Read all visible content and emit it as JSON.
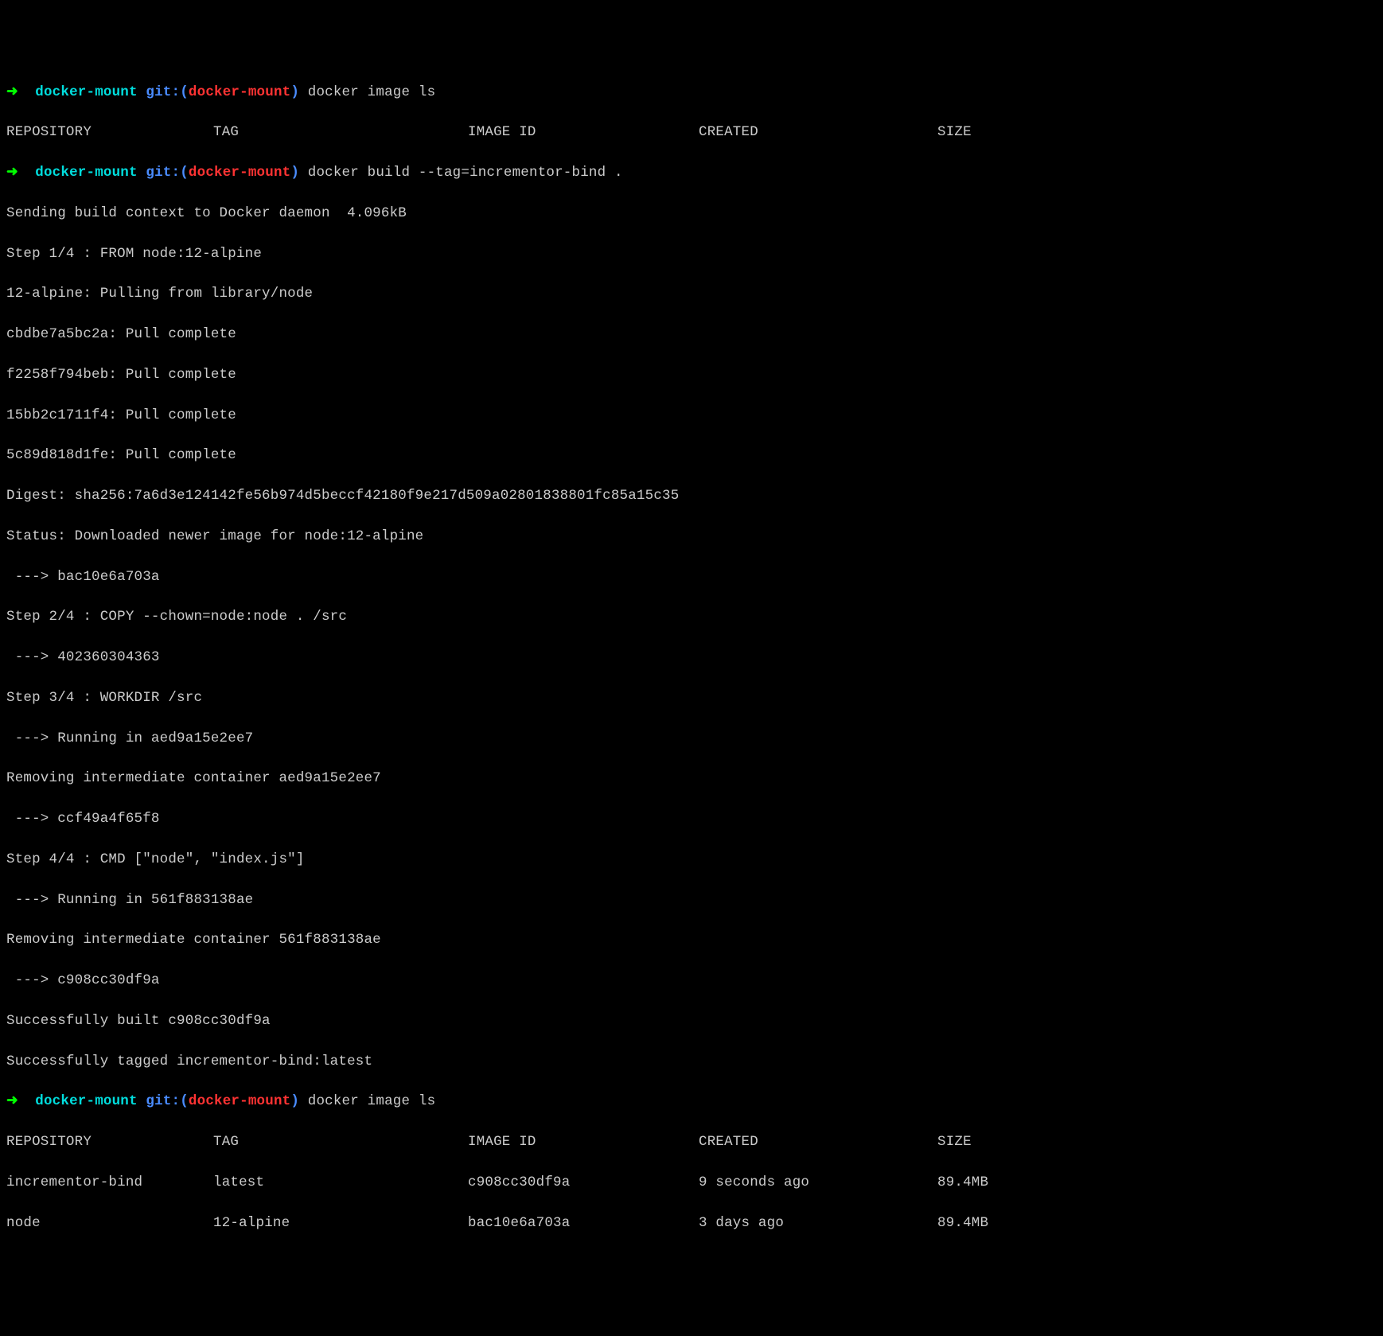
{
  "prompt": {
    "arrow": "➜",
    "dir": "docker-mount",
    "git_label": "git:(",
    "branch": "docker-mount",
    "git_close": ")"
  },
  "cmd1": "docker image ls",
  "table1": {
    "headers": {
      "repo": "REPOSITORY",
      "tag": "TAG",
      "id": "IMAGE ID",
      "created": "CREATED",
      "size": "SIZE"
    }
  },
  "cmd2": "docker build --tag=incrementor-bind .",
  "build_output": {
    "l0": "Sending build context to Docker daemon  4.096kB",
    "l1": "Step 1/4 : FROM node:12-alpine",
    "l2": "12-alpine: Pulling from library/node",
    "l3": "cbdbe7a5bc2a: Pull complete",
    "l4": "f2258f794beb: Pull complete",
    "l5": "15bb2c1711f4: Pull complete",
    "l6": "5c89d818d1fe: Pull complete",
    "l7": "Digest: sha256:7a6d3e124142fe56b974d5beccf42180f9e217d509a02801838801fc85a15c35",
    "l8": "Status: Downloaded newer image for node:12-alpine",
    "l9": " ---> bac10e6a703a",
    "l10": "Step 2/4 : COPY --chown=node:node . /src",
    "l11": " ---> 402360304363",
    "l12": "Step 3/4 : WORKDIR /src",
    "l13": " ---> Running in aed9a15e2ee7",
    "l14": "Removing intermediate container aed9a15e2ee7",
    "l15": " ---> ccf49a4f65f8",
    "l16": "Step 4/4 : CMD [\"node\", \"index.js\"]",
    "l17": " ---> Running in 561f883138ae",
    "l18": "Removing intermediate container 561f883138ae",
    "l19": " ---> c908cc30df9a",
    "l20": "Successfully built c908cc30df9a",
    "l21": "Successfully tagged incrementor-bind:latest"
  },
  "cmd3": "docker image ls",
  "table2": {
    "headers": {
      "repo": "REPOSITORY",
      "tag": "TAG",
      "id": "IMAGE ID",
      "created": "CREATED",
      "size": "SIZE"
    },
    "rows": [
      {
        "repo": "incrementor-bind",
        "tag": "latest",
        "id": "c908cc30df9a",
        "created": "9 seconds ago",
        "size": "89.4MB"
      },
      {
        "repo": "node",
        "tag": "12-alpine",
        "id": "bac10e6a703a",
        "created": "3 days ago",
        "size": "89.4MB"
      }
    ]
  }
}
